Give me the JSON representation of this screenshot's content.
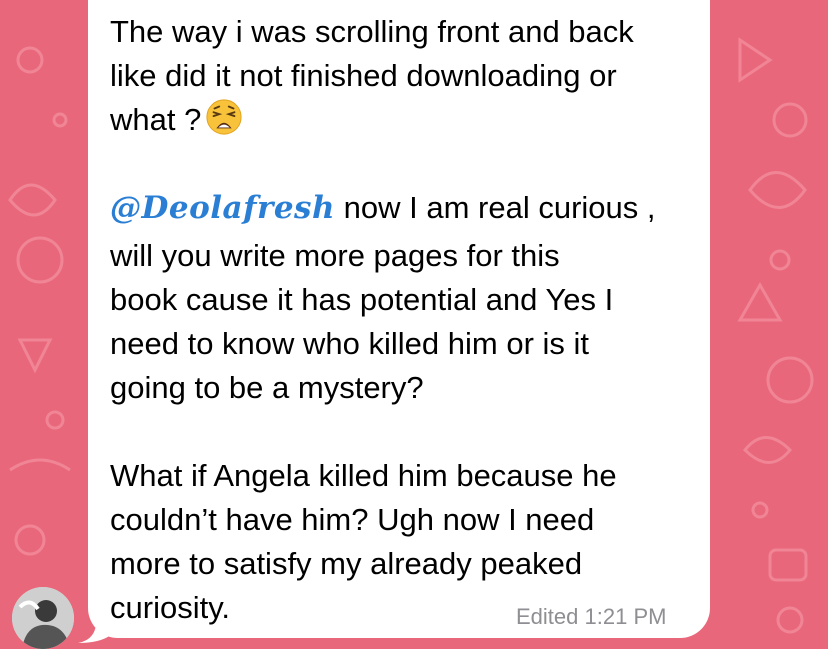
{
  "message": {
    "paragraph1": "The way i was scrolling front and back\nlike did it not finished downloading or\nwhat ?",
    "emoji_name": "weary-face",
    "mention": "@Deolafresh",
    "paragraph2_first": " now I am real curious ,",
    "paragraph2_rest": "will you write more pages for this\nbook cause it has potential and Yes I\nneed to know who killed him or is it\ngoing to be a mystery?",
    "paragraph3": "What if Angela killed him because he\ncouldn’t have him? Ugh now I need\nmore to satisfy my already peaked\ncuriosity."
  },
  "meta": {
    "status": "Edited",
    "time": "1:21 PM"
  },
  "colors": {
    "wallpaper": "#e9677a",
    "bubble": "#ffffff",
    "mention": "#2a7fd4",
    "meta_text": "#8e8e93"
  },
  "icons": {
    "emoji": "weary-face-emoji",
    "avatar": "sender-avatar"
  }
}
